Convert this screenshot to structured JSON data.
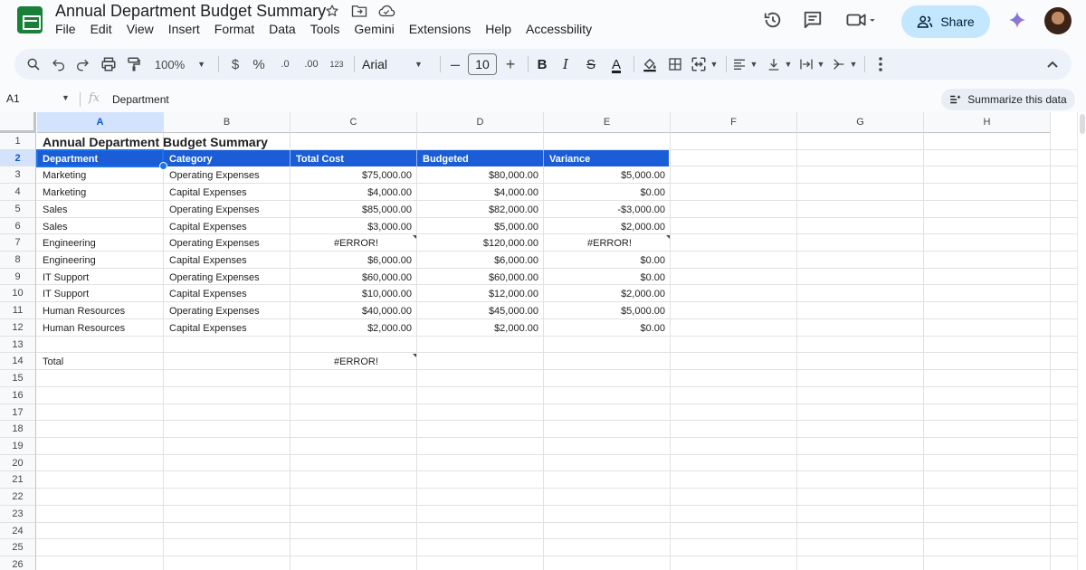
{
  "window": {
    "title": "Annual Department Budget Summary",
    "menu": [
      "File",
      "Edit",
      "View",
      "Insert",
      "Format",
      "Data",
      "Tools",
      "Gemini",
      "Extensions",
      "Help",
      "Accessbility"
    ],
    "share_label": "Share"
  },
  "toolbar": {
    "zoom": "100%",
    "currency": "$",
    "percent": "%",
    "decrease_decimal": ".0",
    "increase_decimal": ".00",
    "number_format": "123",
    "font": "Arial",
    "font_size": "10",
    "bold": "B",
    "italic": "I",
    "strikethrough": "S",
    "text_color": "A"
  },
  "formula_bar": {
    "name_box": "A1",
    "fx": "fx",
    "content": "Department",
    "summarize_label": "Summarize this data"
  },
  "sheet": {
    "columns": [
      "A",
      "B",
      "C",
      "D",
      "E",
      "F",
      "G",
      "H"
    ],
    "rows": [
      "1",
      "2",
      "3",
      "4",
      "5",
      "6",
      "7",
      "8",
      "9",
      "10",
      "11",
      "12",
      "13",
      "14",
      "15",
      "16",
      "17",
      "18",
      "19",
      "20",
      "21",
      "22",
      "23",
      "24",
      "25",
      "26"
    ],
    "title": "Annual Department Budget Summary",
    "headers": [
      "Department",
      "Category",
      "Total Cost",
      "Budgeted",
      "Variance"
    ],
    "data": [
      [
        "Marketing",
        "Operating Expenses",
        "$75,000.00",
        "$80,000.00",
        "$5,000.00"
      ],
      [
        "Marketing",
        "Capital Expenses",
        "$4,000.00",
        "$4,000.00",
        "$0.00"
      ],
      [
        "Sales",
        "Operating Expenses",
        "$85,000.00",
        "$82,000.00",
        "-$3,000.00"
      ],
      [
        "Sales",
        "Capital Expenses",
        "$3,000.00",
        "$5,000.00",
        "$2,000.00"
      ],
      [
        "Engineering",
        "Operating Expenses",
        "#ERROR!",
        "$120,000.00",
        "#ERROR!"
      ],
      [
        "Engineering",
        "Capital Expenses",
        "$6,000.00",
        "$6,000.00",
        "$0.00"
      ],
      [
        "IT Support",
        "Operating Expenses",
        "$60,000.00",
        "$60,000.00",
        "$0.00"
      ],
      [
        "IT Support",
        "Capital Expenses",
        "$10,000.00",
        "$12,000.00",
        "$2,000.00"
      ],
      [
        "Human Resources",
        "Operating Expenses",
        "$40,000.00",
        "$45,000.00",
        "$5,000.00"
      ],
      [
        "Human Resources",
        "Capital Expenses",
        "$2,000.00",
        "$2,000.00",
        "$0.00"
      ]
    ],
    "total_label": "Total",
    "total_value": "#ERROR!",
    "header_color": "#1a5dd6",
    "selection_color": "#1a73e8"
  },
  "icons": {
    "title_icons": [
      "star-icon",
      "move-to-folder-icon",
      "cloud-saved-icon"
    ],
    "top_right": [
      "version-history-icon",
      "comments-icon",
      "meet-icon",
      "share-people-icon",
      "gemini-sparkle-icon",
      "avatar"
    ]
  }
}
